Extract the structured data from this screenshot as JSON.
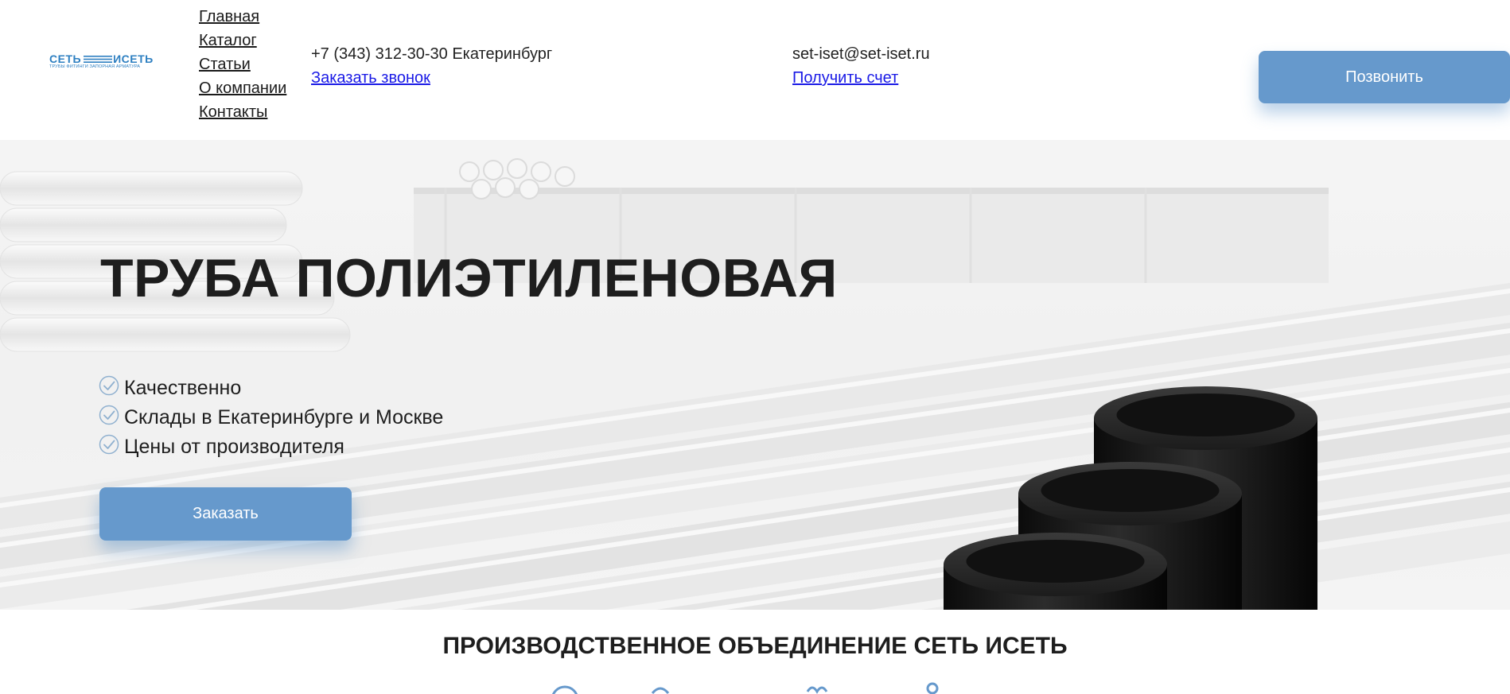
{
  "header": {
    "logo": {
      "left_word": "СЕТЬ",
      "right_word": "ИСЕТЬ",
      "subtitle": "ТРУБЫ ФИТИНГИ ЗАПОРНАЯ АРМАТУРА",
      "color": "#2d7fc1"
    },
    "nav": [
      {
        "label": "Главная"
      },
      {
        "label": "Каталог"
      },
      {
        "label": "Статьи"
      },
      {
        "label": "О компании"
      },
      {
        "label": "Контакты"
      }
    ],
    "phone_text": "+7 (343) 312-30-30 Екатеринбург",
    "callback_link": "Заказать звонок",
    "email_text": "set-iset@set-iset.ru",
    "invoice_link": "Получить счет",
    "call_button": "Позвонить"
  },
  "hero": {
    "title": "ТРУБА ПОЛИЭТИЛЕНОВАЯ",
    "features": [
      {
        "label": "Качественно",
        "icon": "check-circle-icon"
      },
      {
        "label": "Склады в Екатеринбурге и Москве",
        "icon": "check-circle-icon"
      },
      {
        "label": "Цены от производителя",
        "icon": "check-circle-icon"
      }
    ],
    "order_button": "Заказать"
  },
  "section": {
    "title": "ПРОИЗВОДСТВЕННОЕ ОБЪЕДИНЕНИЕ СЕТЬ ИСЕТЬ"
  },
  "colors": {
    "accent": "#6699cc",
    "logo_blue": "#2d7fc1",
    "link_blue": "#1a1ae6",
    "text_dark": "#1e1e1e"
  }
}
